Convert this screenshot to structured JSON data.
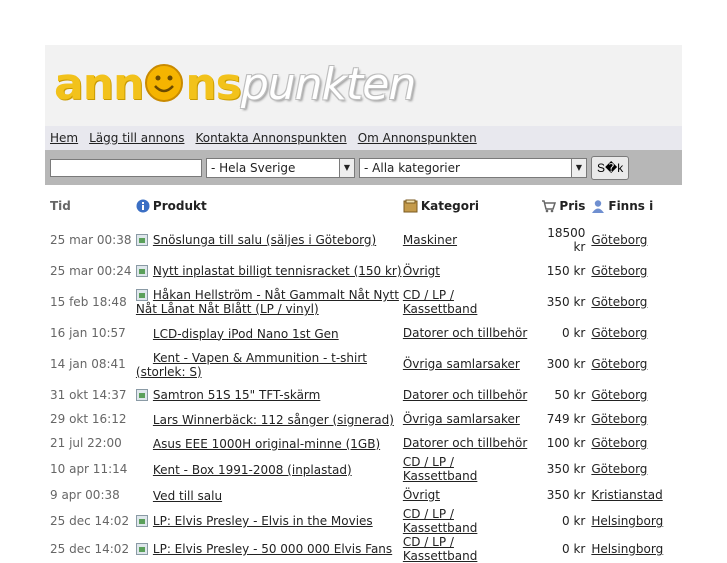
{
  "logo": {
    "part1": "ann",
    "part2": "ns",
    "part3": "punkten"
  },
  "nav": [
    "Hem",
    "Lägg till annons",
    "Kontakta Annonspunkten",
    "Om Annonspunkten"
  ],
  "search": {
    "input_value": "",
    "region": "- Hela Sverige",
    "category": "- Alla kategorier",
    "button": "S�k"
  },
  "headers": {
    "time": "Tid",
    "product": "Produkt",
    "category": "Kategori",
    "price": "Pris",
    "location": "Finns i"
  },
  "rows": [
    {
      "time": "25 mar 00:38",
      "product": "Snöslunga till salu (säljes i Göteborg)",
      "category": "Maskiner",
      "price": "18500 kr",
      "location": "Göteborg",
      "pic": true
    },
    {
      "time": "25 mar 00:24",
      "product": "Nytt inplastat billigt tennisracket (150 kr)",
      "category": "Övrigt",
      "price": "150 kr",
      "location": "Göteborg",
      "pic": true
    },
    {
      "time": "15 feb 18:48",
      "product": "Håkan Hellström - Nåt Gammalt Nåt Nytt Nåt Lånat Nåt Blått (LP / vinyl)",
      "category": "CD / LP / Kassettband",
      "price": "350 kr",
      "location": "Göteborg",
      "pic": true
    },
    {
      "time": "16 jan 10:57",
      "product": "LCD-display iPod Nano 1st Gen",
      "category": "Datorer och tillbehör",
      "price": "0 kr",
      "location": "Göteborg",
      "pic": false
    },
    {
      "time": "14 jan 08:41",
      "product": "Kent - Vapen & Ammunition - t-shirt (storlek: S)",
      "category": "Övriga samlarsaker",
      "price": "300 kr",
      "location": "Göteborg",
      "pic": false
    },
    {
      "time": "31 okt 14:37",
      "product": "Samtron 51S 15\" TFT-skärm",
      "category": "Datorer och tillbehör",
      "price": "50 kr",
      "location": "Göteborg",
      "pic": true
    },
    {
      "time": "29 okt 16:12",
      "product": "Lars Winnerbäck: 112 sånger (signerad)",
      "category": "Övriga samlarsaker",
      "price": "749 kr",
      "location": "Göteborg",
      "pic": false
    },
    {
      "time": "21 jul 22:00",
      "product": "Asus EEE 1000H original-minne (1GB)",
      "category": "Datorer och tillbehör",
      "price": "100 kr",
      "location": "Göteborg",
      "pic": false
    },
    {
      "time": "10 apr 11:14",
      "product": "Kent - Box 1991-2008 (inplastad)",
      "category": "CD / LP / Kassettband",
      "price": "350 kr",
      "location": "Göteborg",
      "pic": false
    },
    {
      "time": "9 apr 00:38",
      "product": "Ved till salu",
      "category": "Övrigt",
      "price": "350 kr",
      "location": "Kristianstad",
      "pic": false
    },
    {
      "time": "25 dec 14:02",
      "product": "LP: Elvis Presley - Elvis in the Movies",
      "category": "CD / LP / Kassettband",
      "price": "0 kr",
      "location": "Helsingborg",
      "pic": true
    },
    {
      "time": "25 dec 14:02",
      "product": "LP: Elvis Presley - 50 000 000 Elvis Fans",
      "category": "CD / LP / Kassettband",
      "price": "0 kr",
      "location": "Helsingborg",
      "pic": true
    }
  ],
  "colors": {
    "logo_yellow": "#f2c21b",
    "search_bar": "#b7b7b7",
    "header_bg": "#f2f2f2",
    "nav_bg": "#e8e8ee"
  }
}
